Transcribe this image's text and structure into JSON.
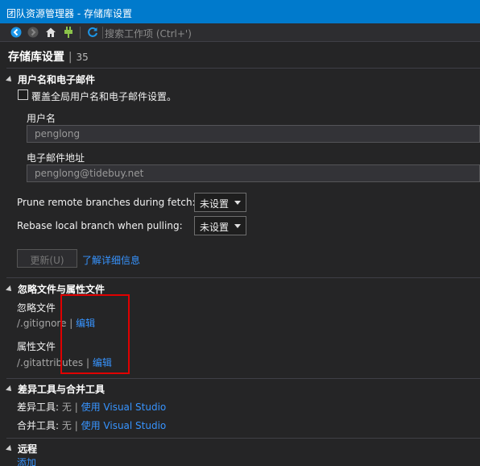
{
  "window": {
    "title": "团队资源管理器 - 存储库设置"
  },
  "toolbar": {
    "search_placeholder": "搜索工作项 (Ctrl+')"
  },
  "page": {
    "title": "存储库设置",
    "separator": "|",
    "count": "35"
  },
  "user_section": {
    "header": "用户名和电子邮件",
    "override_label": "覆盖全局用户名和电子邮件设置。",
    "override_checked": false,
    "username_label": "用户名",
    "username_value": "penglong",
    "email_label": "电子邮件地址",
    "email_value": "penglong@tidebuy.net",
    "prune_label": "Prune remote branches during fetch:",
    "prune_value": "未设置",
    "rebase_label": "Rebase local branch when pulling:",
    "rebase_value": "未设置",
    "update_button": "更新(U)",
    "learn_more_link": "了解详细信息"
  },
  "ignore_section": {
    "header": "忽略文件与属性文件",
    "ignore_label": "忽略文件",
    "ignore_path": "/.gitignore",
    "separator": "|",
    "ignore_edit": "编辑",
    "attr_label": "属性文件",
    "attr_path": "/.gitattributes",
    "attr_edit": "编辑"
  },
  "tools_section": {
    "header": "差异工具与合并工具",
    "diff_label": "差异工具:",
    "diff_value": "无",
    "diff_link": "使用 Visual Studio",
    "merge_label": "合并工具:",
    "merge_value": "无",
    "merge_link": "使用 Visual Studio",
    "separator": "|"
  },
  "remote_section": {
    "header": "远程",
    "add_link": "添加"
  },
  "colors": {
    "titlebar": "#007acc",
    "background": "#252526",
    "link": "#3794ff",
    "highlight": "#e00000"
  }
}
